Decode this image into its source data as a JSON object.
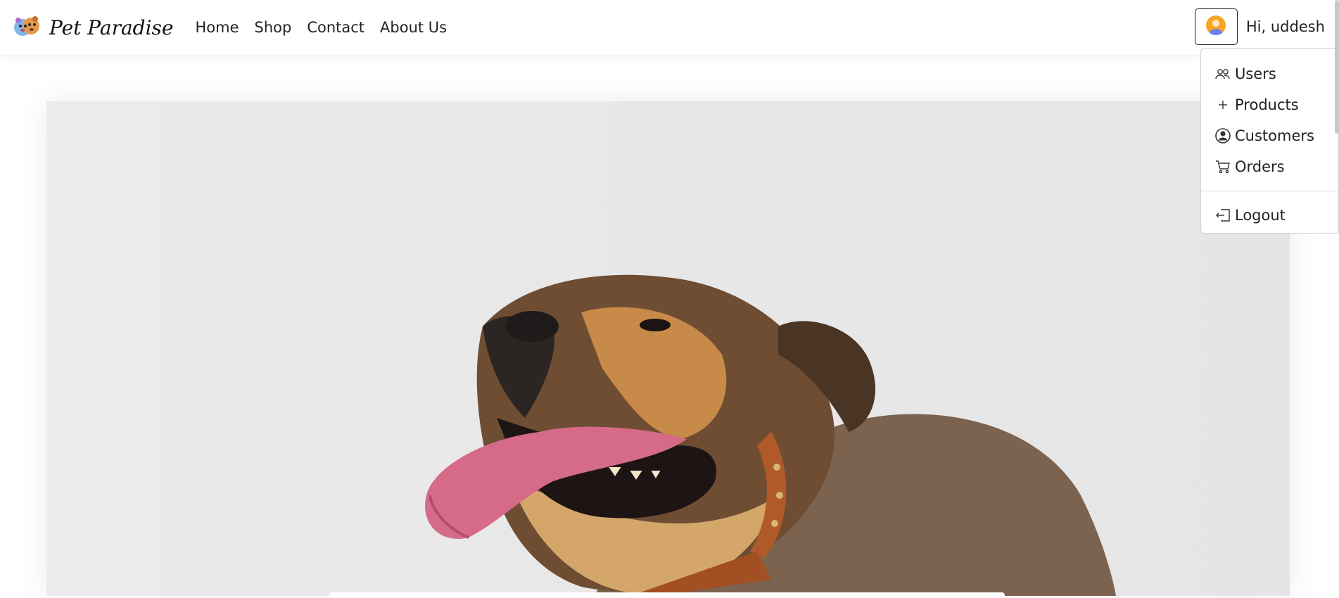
{
  "brand": {
    "name": "Pet Paradise",
    "logo_icon": "pets-logo-icon"
  },
  "nav": {
    "links": [
      "Home",
      "Shop",
      "Contact",
      "About Us"
    ]
  },
  "user": {
    "greeting": "Hi, uddesh",
    "avatar_icon": "user-avatar-icon"
  },
  "dropdown": {
    "items": [
      {
        "label": "Users",
        "icon": "users-icon"
      },
      {
        "label": "Products",
        "icon": "plus-icon"
      },
      {
        "label": "Customers",
        "icon": "person-circle-icon"
      },
      {
        "label": "Orders",
        "icon": "cart-icon"
      }
    ],
    "logout": {
      "label": "Logout",
      "icon": "logout-icon"
    }
  },
  "hero": {
    "image": "dog-photo"
  },
  "colors": {
    "accent_orange": "#f5a623",
    "avatar_blue": "#6f7cf0"
  }
}
